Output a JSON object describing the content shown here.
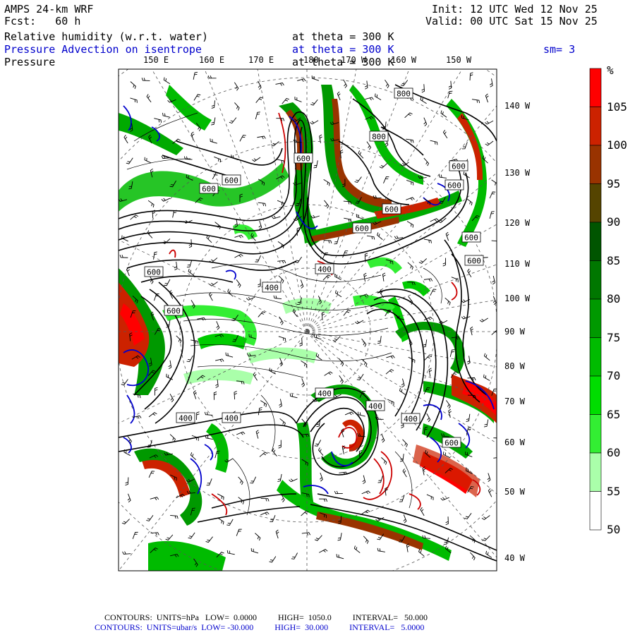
{
  "header": {
    "model": "AMPS 24-km WRF",
    "fcst": "Fcst:   60 h",
    "init": "Init: 12 UTC Wed 12 Nov 25",
    "valid": "Valid: 00 UTC Sat 15 Nov 25",
    "fields": [
      {
        "name": "Relative humidity (w.r.t. water)",
        "level": "at theta = 300 K",
        "color": "#000000"
      },
      {
        "name": "Pressure Advection on isentrope",
        "level": "at theta = 300 K",
        "extra": "sm= 3",
        "color": "#0000cc"
      },
      {
        "name": "Pressure",
        "level": "at theta = 300 K",
        "color": "#000000"
      }
    ]
  },
  "map": {
    "top_lon_labels": [
      "150 E",
      "160 E",
      "170 E",
      "180",
      "170 W",
      "160 W",
      "150 W"
    ],
    "right_lon_labels": [
      "140 W",
      "130 W",
      "120 W",
      "110 W",
      "100 W",
      "90 W",
      "80 W",
      "70 W",
      "60 W",
      "50 W",
      "40 W"
    ],
    "pressure_labels": [
      "800",
      "800",
      "600",
      "600",
      "600",
      "600",
      "600",
      "600",
      "600",
      "600",
      "400",
      "600",
      "600",
      "400",
      "400",
      "400",
      "400",
      "400",
      "400",
      "600",
      "600"
    ]
  },
  "colorbar": {
    "unit": "%",
    "labels": [
      "105",
      "100",
      "95",
      "90",
      "85",
      "80",
      "75",
      "70",
      "65",
      "60",
      "55",
      "50"
    ],
    "colors": [
      "#ff0000",
      "#cc2200",
      "#993300",
      "#554400",
      "#005500",
      "#007700",
      "#009900",
      "#00bb00",
      "#00dd00",
      "#33ee33",
      "#aaffaa",
      "#ffffff"
    ]
  },
  "footer": {
    "line1": "CONTOURS:  UNITS=hPa   LOW=  0.0000          HIGH=  1050.0          INTERVAL=   50.000",
    "line2": "CONTOURS:  UNITS=ubar/s  LOW= -30.000          HIGH=  30.000          INTERVAL=   5.0000"
  }
}
